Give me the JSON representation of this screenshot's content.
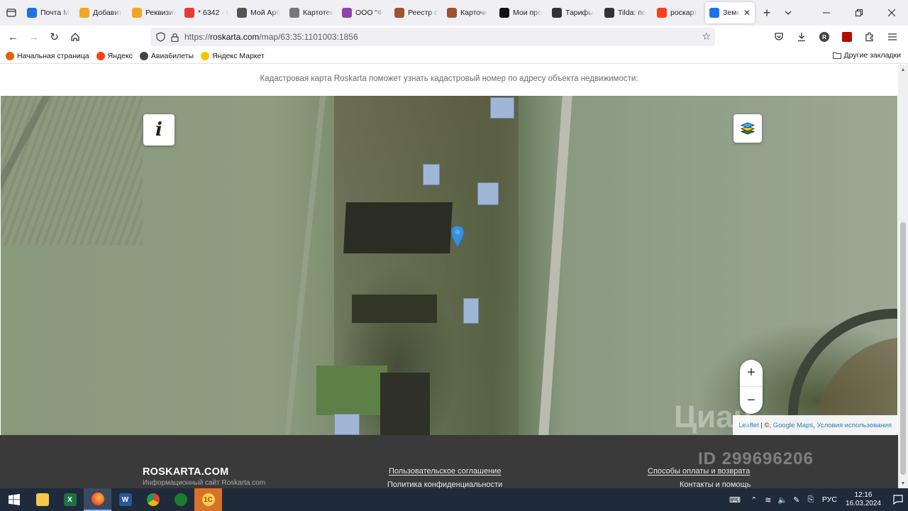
{
  "browser": {
    "tabs": [
      {
        "label": "Почта M",
        "icon": "mail-icon",
        "color": "#1a73e8"
      },
      {
        "label": "Добавит",
        "icon": "circle-icon",
        "color": "#f5a623"
      },
      {
        "label": "Реквизит",
        "icon": "circle-icon",
        "color": "#f5a623"
      },
      {
        "label": "* 6342 · В",
        "icon": "flag-icon",
        "color": "#e53935"
      },
      {
        "label": "Мой Арб",
        "icon": "scales-icon",
        "color": "#555555"
      },
      {
        "label": "Картотек",
        "icon": "file-icon",
        "color": "#777777"
      },
      {
        "label": "ООО \"Ф",
        "icon": "spiral-icon",
        "color": "#8e44ad"
      },
      {
        "label": "Реестр с",
        "icon": "emblem-icon",
        "color": "#a0522d"
      },
      {
        "label": "Карточк",
        "icon": "emblem-icon",
        "color": "#a0522d"
      },
      {
        "label": "Мои про",
        "icon": "k-icon",
        "color": "#111111"
      },
      {
        "label": "Тарифы",
        "icon": "t-icon",
        "color": "#333333"
      },
      {
        "label": "Tilda: по",
        "icon": "t-icon",
        "color": "#333333"
      },
      {
        "label": "роскарт",
        "icon": "yandex-icon",
        "color": "#fc3f1d"
      },
      {
        "label": "Земел",
        "icon": "check-icon",
        "color": "#1a73e8",
        "active": true
      }
    ],
    "url_prefix": "https://",
    "url_domain": "roskarta.com",
    "url_path": "/map/63:35:1101003:1856",
    "bookmarks": [
      {
        "label": "Начальная страница",
        "icon": "firefox-icon",
        "color": "#e66000"
      },
      {
        "label": "Яндекс",
        "icon": "yandex-icon",
        "color": "#fc3f1d"
      },
      {
        "label": "Авиабилеты",
        "icon": "globe-icon",
        "color": "#444444"
      },
      {
        "label": "Яндекс Маркет",
        "icon": "market-icon",
        "color": "#f5c400"
      }
    ],
    "other_bookmarks": "Другие закладки"
  },
  "page": {
    "intro": "Кадастровая карта Roskarta поможет узнать кадастровый номер по адресу объекта недвижимости:",
    "map": {
      "info_button": "i",
      "zoom_in": "+",
      "zoom_out": "−",
      "attribution_leaflet": "Leaflet",
      "attribution_sep": " | ©, ",
      "attribution_google": "Google Maps",
      "attribution_terms": "Условия использования"
    },
    "footer": {
      "brand": "ROSKARTA.COM",
      "subtitle": "Информационный сайт Roskarta.com",
      "links": [
        "Пользовательское соглашение",
        "Политика конфиденциальности",
        "Способы оплаты и возврата",
        "Контакты и помощь"
      ]
    },
    "watermark": {
      "brand": "Циан",
      "id": "ID 299696206"
    }
  },
  "taskbar": {
    "language": "РУС",
    "time": "12:16",
    "date": "16.03.2024"
  }
}
